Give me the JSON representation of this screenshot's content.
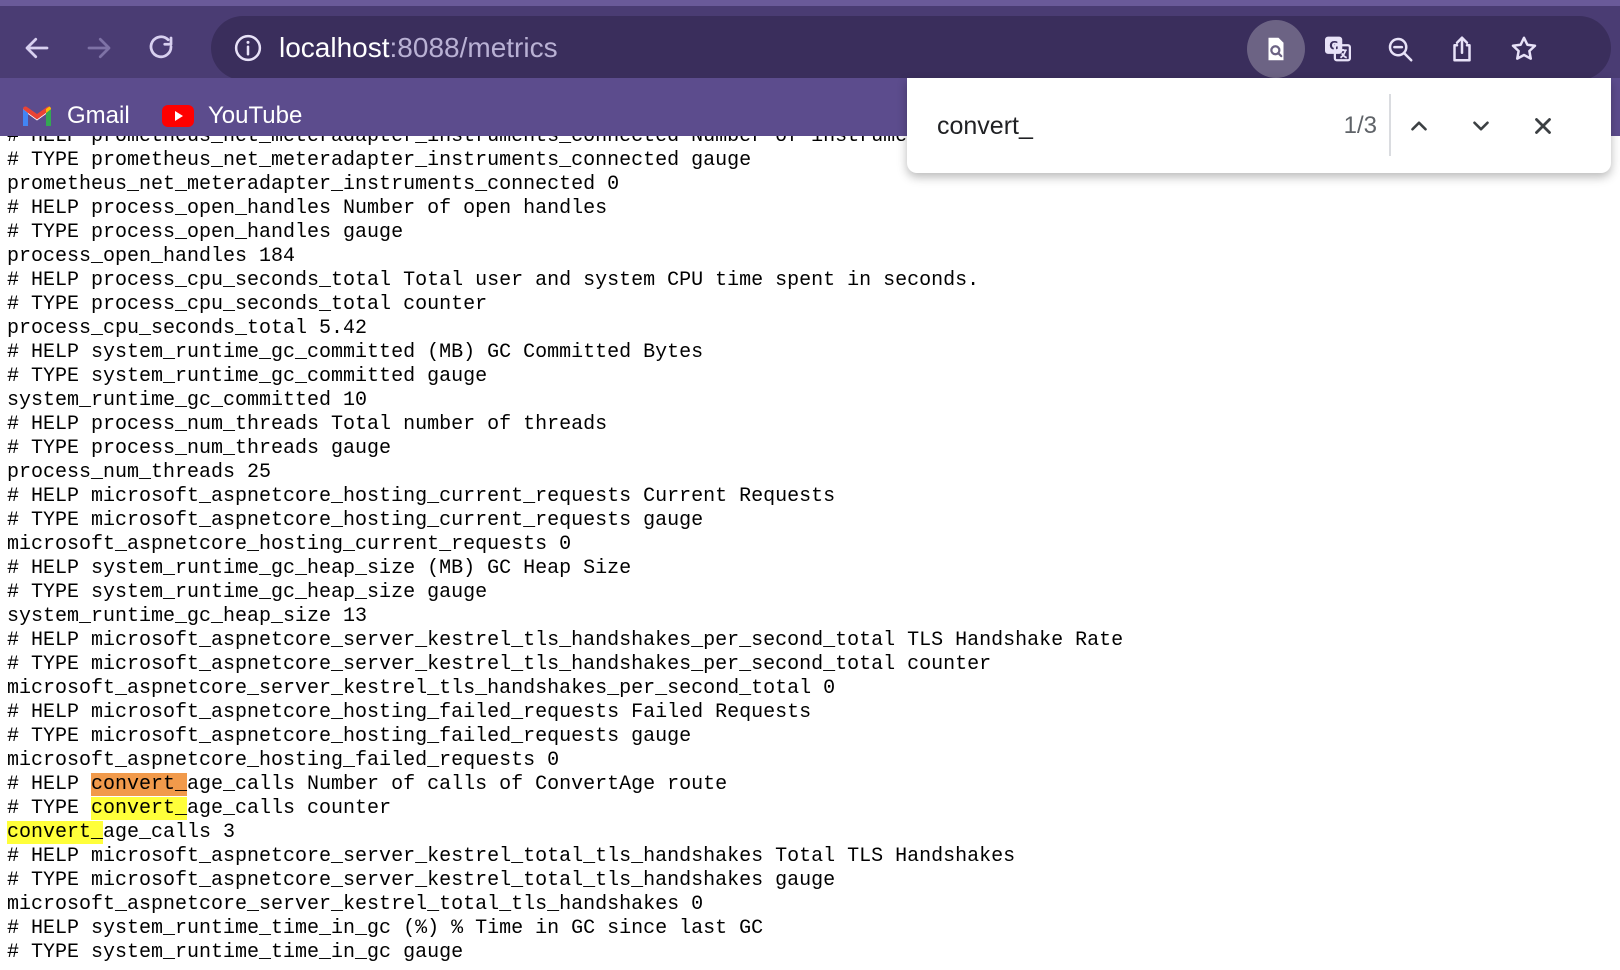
{
  "browser": {
    "url_host": "localhost",
    "url_rest": ":8088/metrics",
    "accent_color": "#4a3c73",
    "bookmarks": [
      {
        "label": "Gmail",
        "icon": "gmail-icon"
      },
      {
        "label": "YouTube",
        "icon": "youtube-icon"
      }
    ],
    "toolbar_icons": [
      "back-icon",
      "forward-icon",
      "reload-icon",
      "info-icon",
      "find-in-page-icon",
      "translate-icon",
      "zoom-icon",
      "share-icon",
      "bookmark-star-icon"
    ]
  },
  "find": {
    "query": "convert_",
    "count": "1/3",
    "highlight_color": "#ffff3a",
    "current_highlight_color": "#f19a4b"
  },
  "metrics_lines": [
    "# HELP prometheus_net_meteradapter_instruments_connected Number of instruments that are currently connected to the adapter.",
    "# TYPE prometheus_net_meteradapter_instruments_connected gauge",
    "prometheus_net_meteradapter_instruments_connected 0",
    "# HELP process_open_handles Number of open handles",
    "# TYPE process_open_handles gauge",
    "process_open_handles 184",
    "# HELP process_cpu_seconds_total Total user and system CPU time spent in seconds.",
    "# TYPE process_cpu_seconds_total counter",
    "process_cpu_seconds_total 5.42",
    "# HELP system_runtime_gc_committed (MB) GC Committed Bytes",
    "# TYPE system_runtime_gc_committed gauge",
    "system_runtime_gc_committed 10",
    "# HELP process_num_threads Total number of threads",
    "# TYPE process_num_threads gauge",
    "process_num_threads 25",
    "# HELP microsoft_aspnetcore_hosting_current_requests Current Requests",
    "# TYPE microsoft_aspnetcore_hosting_current_requests gauge",
    "microsoft_aspnetcore_hosting_current_requests 0",
    "# HELP system_runtime_gc_heap_size (MB) GC Heap Size",
    "# TYPE system_runtime_gc_heap_size gauge",
    "system_runtime_gc_heap_size 13",
    "# HELP microsoft_aspnetcore_server_kestrel_tls_handshakes_per_second_total TLS Handshake Rate",
    "# TYPE microsoft_aspnetcore_server_kestrel_tls_handshakes_per_second_total counter",
    "microsoft_aspnetcore_server_kestrel_tls_handshakes_per_second_total 0",
    "# HELP microsoft_aspnetcore_hosting_failed_requests Failed Requests",
    "# TYPE microsoft_aspnetcore_hosting_failed_requests gauge",
    "microsoft_aspnetcore_hosting_failed_requests 0",
    "# HELP convert_age_calls Number of calls of ConvertAge route",
    "# TYPE convert_age_calls counter",
    "convert_age_calls 3",
    "# HELP microsoft_aspnetcore_server_kestrel_total_tls_handshakes Total TLS Handshakes",
    "# TYPE microsoft_aspnetcore_server_kestrel_total_tls_handshakes gauge",
    "microsoft_aspnetcore_server_kestrel_total_tls_handshakes 0",
    "# HELP system_runtime_time_in_gc (%) % Time in GC since last GC",
    "# TYPE system_runtime_time_in_gc gauge"
  ]
}
